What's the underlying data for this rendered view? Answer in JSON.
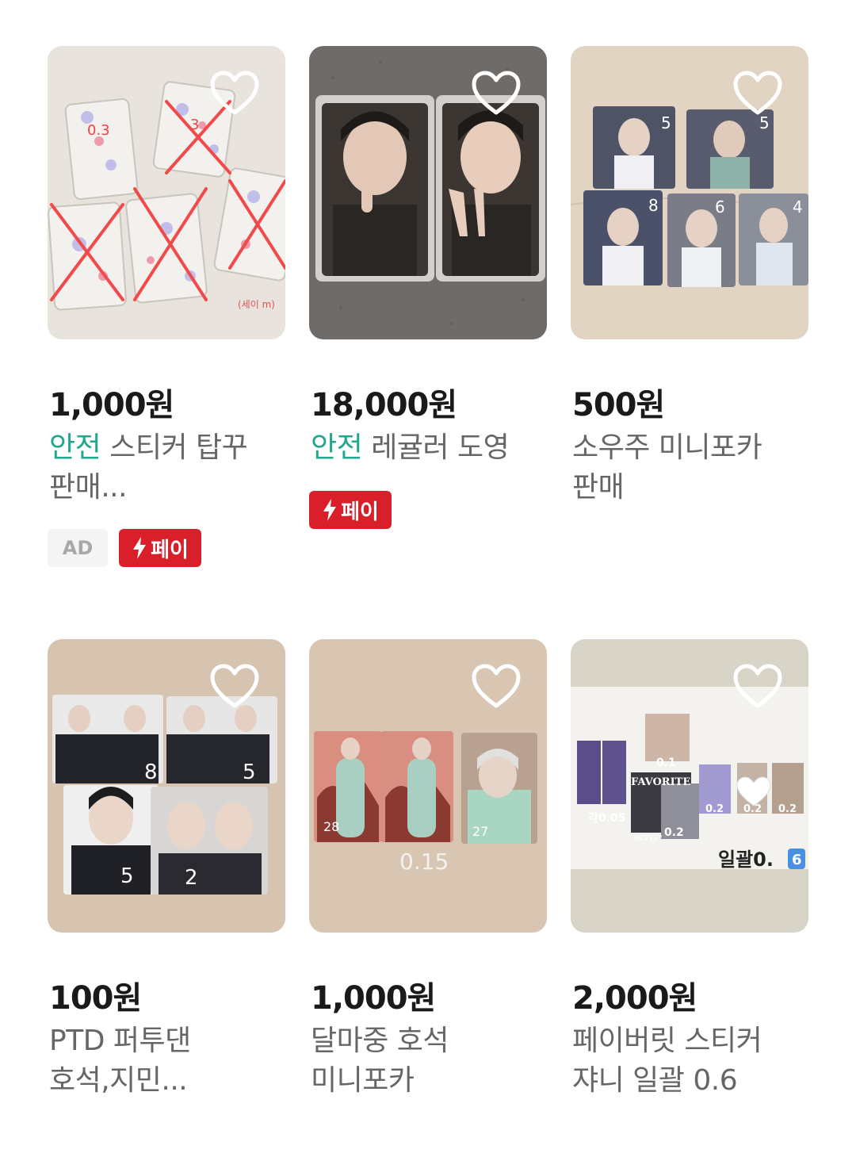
{
  "products": [
    {
      "price": "1,000원",
      "safe_tag": "안전",
      "title_line1": " 스티커 탑꾸",
      "title_line2": "판매...",
      "ad_badge": "AD",
      "pay_badge": "페이"
    },
    {
      "price": "18,000원",
      "safe_tag": "안전",
      "title_line1": " 레귤러 도영",
      "title_line2": "",
      "pay_badge": "페이"
    },
    {
      "price": "500원",
      "title_line1": "소우주 미니포카",
      "title_line2": "판매"
    },
    {
      "price": "100원",
      "title_line1": "PTD 퍼투댄",
      "title_line2": "호석,지민...",
      "image_labels": [
        "8",
        "5",
        "5",
        "2"
      ]
    },
    {
      "price": "1,000원",
      "title_line1": "달마중 호석",
      "title_line2": "미니포카",
      "image_labels": [
        "28",
        "27",
        "0.15"
      ]
    },
    {
      "price": "2,000원",
      "title_line1": "페이버릿 스티커",
      "title_line2": "쟈니 일괄 0.6",
      "image_labels": [
        "FAVORITE",
        "0.1",
        "각0.05",
        "0.2",
        "0.2",
        "0.2",
        "0.2",
        "NCT127",
        "일괄0.",
        "6"
      ]
    }
  ],
  "image_labels_top": {
    "card1": [
      "0.3",
      "3",
      "(세이 m)"
    ],
    "card3": [
      "5",
      "5",
      "8",
      "6",
      "4"
    ]
  },
  "colors": {
    "safe_green": "#21a78b",
    "pay_red": "#d9202a",
    "price_text": "#1a1a1a",
    "title_text": "#666666"
  },
  "icons": {
    "wishlist": "heart-outline-icon",
    "pay": "lightning-bolt-icon"
  }
}
